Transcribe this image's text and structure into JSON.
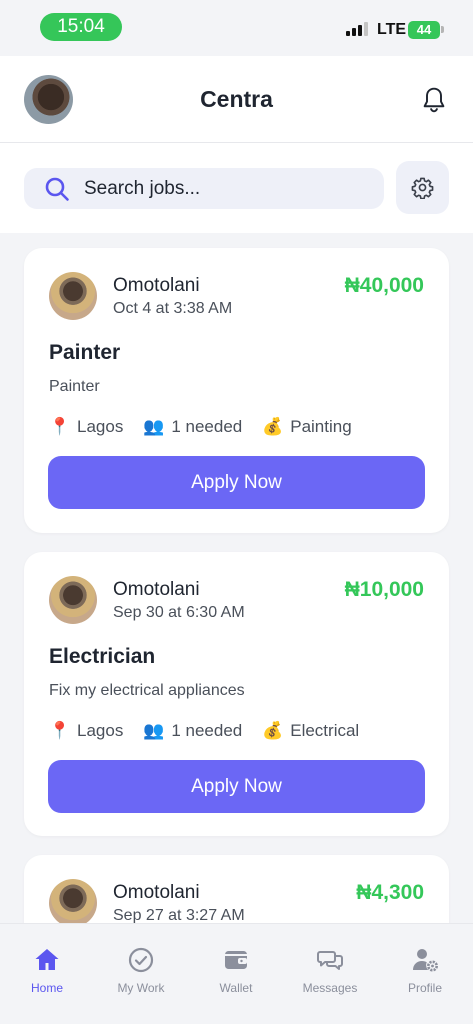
{
  "status_bar": {
    "time": "15:04",
    "network": "LTE",
    "battery": "44"
  },
  "header": {
    "title": "Centra"
  },
  "search": {
    "placeholder": "Search jobs..."
  },
  "jobs": [
    {
      "poster": "Omotolani",
      "posted_at": "Oct 4 at 3:38 AM",
      "price": "₦40,000",
      "title": "Painter",
      "description": "Painter",
      "location": "Lagos",
      "needed": "1 needed",
      "category": "Painting",
      "action": "Apply Now"
    },
    {
      "poster": "Omotolani",
      "posted_at": "Sep 30 at 6:30 AM",
      "price": "₦10,000",
      "title": "Electrician",
      "description": "Fix my electrical appliances",
      "location": "Lagos",
      "needed": "1 needed",
      "category": "Electrical",
      "action": "Apply Now"
    },
    {
      "poster": "Omotolani",
      "posted_at": "Sep 27 at 3:27 AM",
      "price": "₦4,300"
    }
  ],
  "nav": {
    "items": [
      {
        "label": "Home",
        "icon": "home-icon",
        "active": true
      },
      {
        "label": "My Work",
        "icon": "check-circle-icon",
        "active": false
      },
      {
        "label": "Wallet",
        "icon": "wallet-icon",
        "active": false
      },
      {
        "label": "Messages",
        "icon": "messages-icon",
        "active": false
      },
      {
        "label": "Profile",
        "icon": "profile-settings-icon",
        "active": false
      }
    ]
  },
  "colors": {
    "accent": "#6b67f5",
    "price_green": "#34c759",
    "status_green": "#35c659",
    "nav_active": "#5b56ef",
    "nav_inactive": "#8b8f9c"
  }
}
